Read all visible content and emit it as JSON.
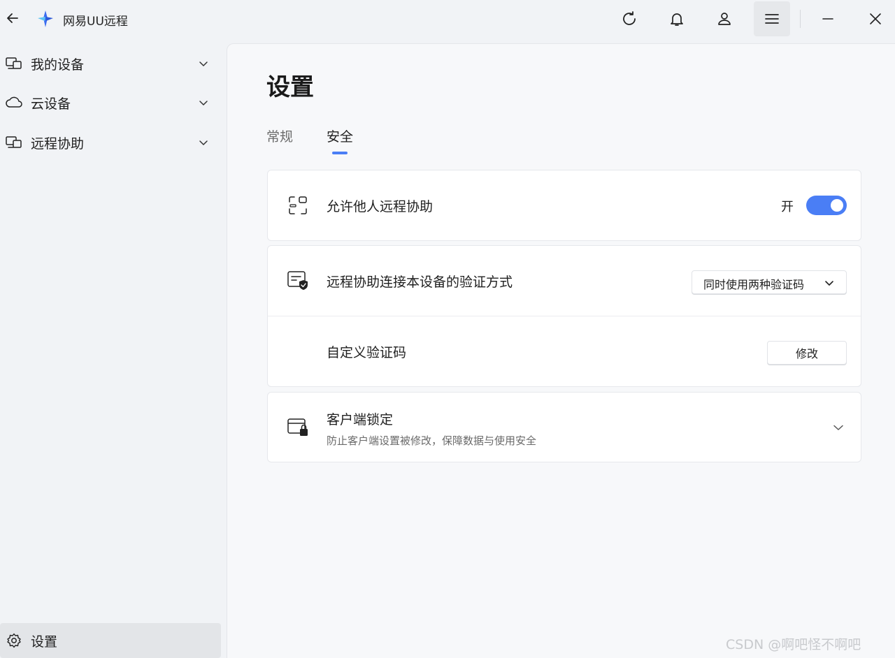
{
  "titlebar": {
    "app_name": "网易UU远程",
    "icons": [
      "back-arrow-icon",
      "app-logo-icon",
      "refresh-icon",
      "bell-icon",
      "user-icon",
      "menu-icon",
      "minimize-icon",
      "close-icon"
    ]
  },
  "sidebar": {
    "items": [
      {
        "label": "我的设备",
        "icon": "devices-icon"
      },
      {
        "label": "云设备",
        "icon": "cloud-icon"
      },
      {
        "label": "远程协助",
        "icon": "remote-assist-icon"
      }
    ],
    "settings_label": "设置"
  },
  "main": {
    "title": "设置",
    "tabs": [
      {
        "label": "常规",
        "active": false
      },
      {
        "label": "安全",
        "active": true
      }
    ],
    "allow_remote": {
      "label": "允许他人远程协助",
      "state_text": "开",
      "enabled": true
    },
    "verify": {
      "label": "远程协助连接本设备的验证方式",
      "selected": "同时使用两种验证码"
    },
    "custom_code": {
      "label": "自定义验证码",
      "button": "修改"
    },
    "client_lock": {
      "title": "客户端锁定",
      "desc": "防止客户端设置被修改，保障数据与使用安全"
    }
  },
  "watermark": "CSDN @啊吧怪不啊吧",
  "colors": {
    "accent": "#4a7ef5",
    "sidebar_bg": "#f1f3f6",
    "panel_bg": "#f7f8fa",
    "card_bg": "#ffffff"
  }
}
